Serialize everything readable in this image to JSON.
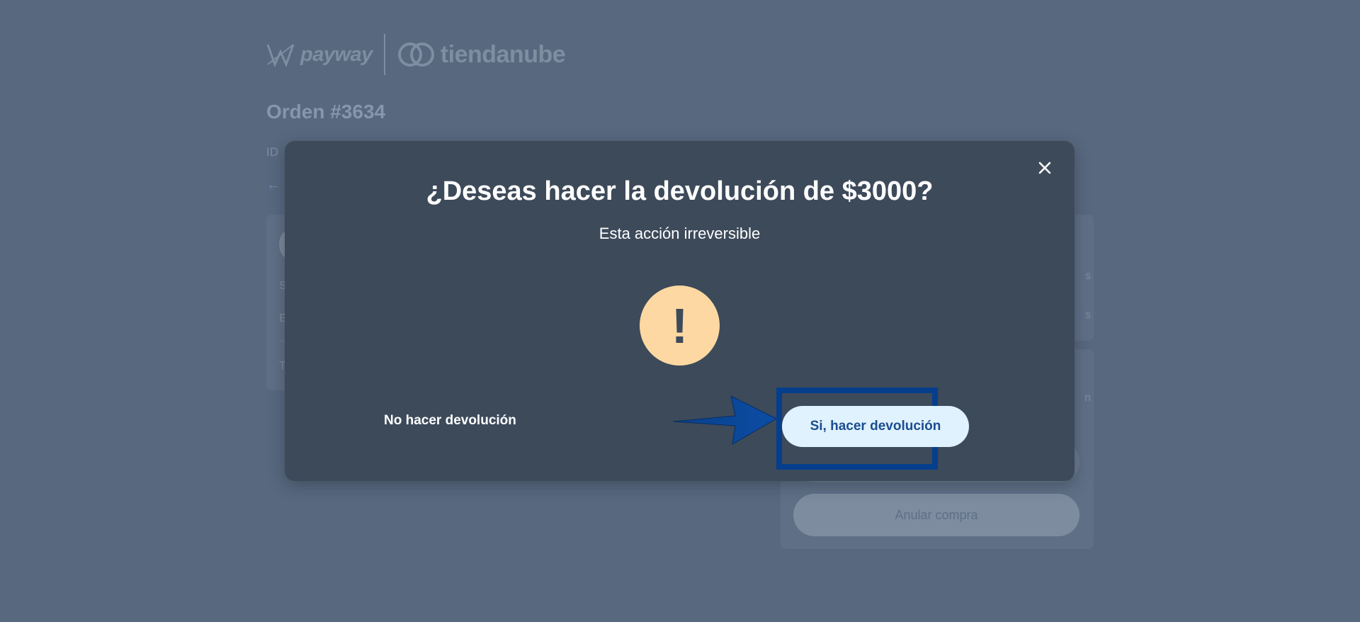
{
  "background": {
    "logo_payway": "payway",
    "logo_tiendanube": "tiendanube",
    "order_title": "Orden #3634",
    "id_label": "ID",
    "card_left_rows": [
      "S",
      "E",
      "T"
    ],
    "card_right_rows": [
      "s",
      "s",
      "n"
    ],
    "cancel_button_label": "Anular compra"
  },
  "modal": {
    "title": "¿Deseas hacer la devolución de $3000?",
    "subtitle": "Esta acción irreversible",
    "warning_icon": "exclamation-icon",
    "warning_symbol": "!",
    "close_icon": "close-icon",
    "cancel_label": "No hacer devolución",
    "confirm_label": "Si, hacer devolución"
  },
  "colors": {
    "overlay_background": "#58687f",
    "modal_background": "#3d4a5a",
    "warning_circle": "#fdd8a2",
    "confirm_button_bg": "#e0f2fd",
    "confirm_button_text": "#1b4d91",
    "highlight_border": "#053e8c"
  }
}
